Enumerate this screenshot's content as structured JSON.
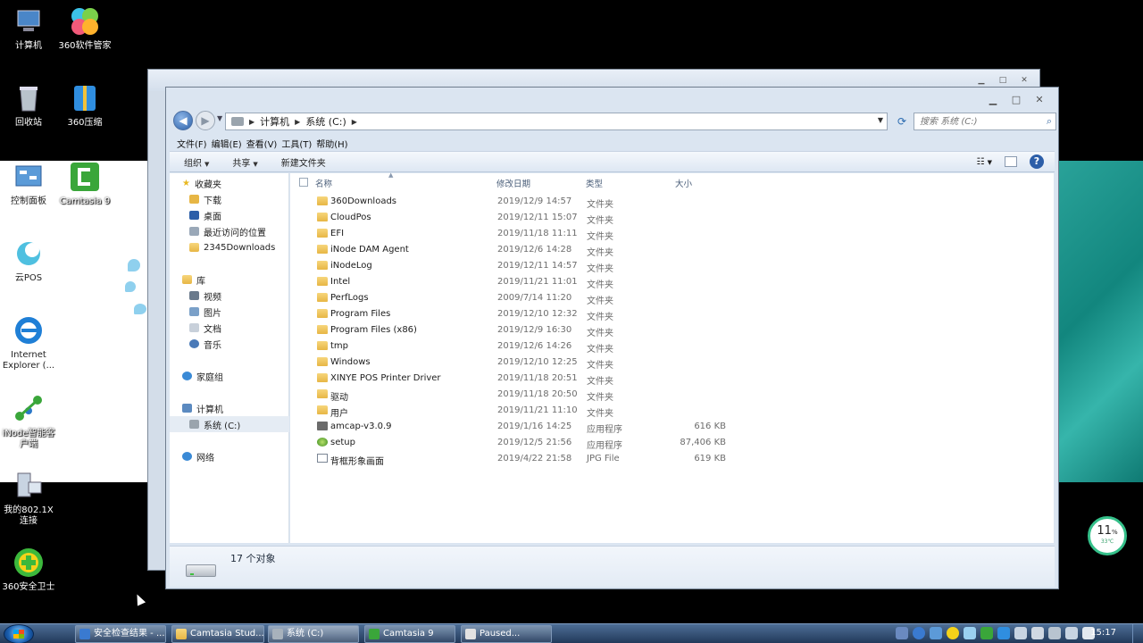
{
  "desktop": {
    "icons": [
      {
        "label": "计算机"
      },
      {
        "label": "360软件管家"
      },
      {
        "label": "回收站"
      },
      {
        "label": "360压缩"
      },
      {
        "label": "控制面板"
      },
      {
        "label": "Camtasia 9"
      },
      {
        "label": "云POS"
      },
      {
        "label": "Internet Explorer (..."
      },
      {
        "label": "iNode智能客户端"
      },
      {
        "label": "我的802.1X 连接"
      },
      {
        "label": "360安全卫士"
      }
    ]
  },
  "explorer": {
    "address": {
      "root": "计算机",
      "drive": "系统 (C:)"
    },
    "search_placeholder": "搜索 系统 (C:)",
    "menu": [
      "文件(F)",
      "编辑(E)",
      "查看(V)",
      "工具(T)",
      "帮助(H)"
    ],
    "toolbar": {
      "organize": "组织",
      "share": "共享",
      "new_folder": "新建文件夹"
    },
    "nav": {
      "favorites": "收藏夹",
      "fav_items": [
        "下载",
        "桌面",
        "最近访问的位置",
        "2345Downloads"
      ],
      "library": "库",
      "lib_items": [
        "视频",
        "图片",
        "文档",
        "音乐"
      ],
      "homegroup": "家庭组",
      "computer": "计算机",
      "computer_items": [
        "系统 (C:)"
      ],
      "network": "网络"
    },
    "columns": {
      "name": "名称",
      "date": "修改日期",
      "type": "类型",
      "size": "大小"
    },
    "files": [
      {
        "name": "360Downloads",
        "date": "2019/12/9 14:57",
        "type": "文件夹",
        "size": "",
        "kind": "folder"
      },
      {
        "name": "CloudPos",
        "date": "2019/12/11 15:07",
        "type": "文件夹",
        "size": "",
        "kind": "folder"
      },
      {
        "name": "EFI",
        "date": "2019/11/18 11:11",
        "type": "文件夹",
        "size": "",
        "kind": "folder"
      },
      {
        "name": "iNode DAM Agent",
        "date": "2019/12/6 14:28",
        "type": "文件夹",
        "size": "",
        "kind": "folder"
      },
      {
        "name": "iNodeLog",
        "date": "2019/12/11 14:57",
        "type": "文件夹",
        "size": "",
        "kind": "folder"
      },
      {
        "name": "Intel",
        "date": "2019/11/21 11:01",
        "type": "文件夹",
        "size": "",
        "kind": "folder"
      },
      {
        "name": "PerfLogs",
        "date": "2009/7/14 11:20",
        "type": "文件夹",
        "size": "",
        "kind": "folder"
      },
      {
        "name": "Program Files",
        "date": "2019/12/10 12:32",
        "type": "文件夹",
        "size": "",
        "kind": "folder"
      },
      {
        "name": "Program Files (x86)",
        "date": "2019/12/9 16:30",
        "type": "文件夹",
        "size": "",
        "kind": "folder"
      },
      {
        "name": "tmp",
        "date": "2019/12/6 14:26",
        "type": "文件夹",
        "size": "",
        "kind": "folder"
      },
      {
        "name": "Windows",
        "date": "2019/12/10 12:25",
        "type": "文件夹",
        "size": "",
        "kind": "folder"
      },
      {
        "name": "XINYE POS Printer Driver",
        "date": "2019/11/18 20:51",
        "type": "文件夹",
        "size": "",
        "kind": "folder"
      },
      {
        "name": "驱动",
        "date": "2019/11/18 20:50",
        "type": "文件夹",
        "size": "",
        "kind": "folder"
      },
      {
        "name": "用户",
        "date": "2019/11/21 11:10",
        "type": "文件夹",
        "size": "",
        "kind": "folder"
      },
      {
        "name": "amcap-v3.0.9",
        "date": "2019/1/16 14:25",
        "type": "应用程序",
        "size": "616 KB",
        "kind": "app"
      },
      {
        "name": "setup",
        "date": "2019/12/5 21:56",
        "type": "应用程序",
        "size": "87,406 KB",
        "kind": "setup"
      },
      {
        "name": "背框形象画面",
        "date": "2019/4/22 21:58",
        "type": "JPG File",
        "size": "619 KB",
        "kind": "jpg"
      }
    ],
    "status": "17 个对象"
  },
  "taskbar": {
    "tasks": [
      "安全检查结果 - ...",
      "Camtasia Stud...",
      "系统 (C:)",
      "Camtasia 9",
      "Paused..."
    ],
    "clock": "15:17"
  },
  "perf": {
    "value": "11",
    "unit": "%",
    "temp": "33℃"
  },
  "colors": {
    "accent": "#2c5ea8",
    "teal": "#1a8f86",
    "taskbar": "#2b4a72"
  }
}
